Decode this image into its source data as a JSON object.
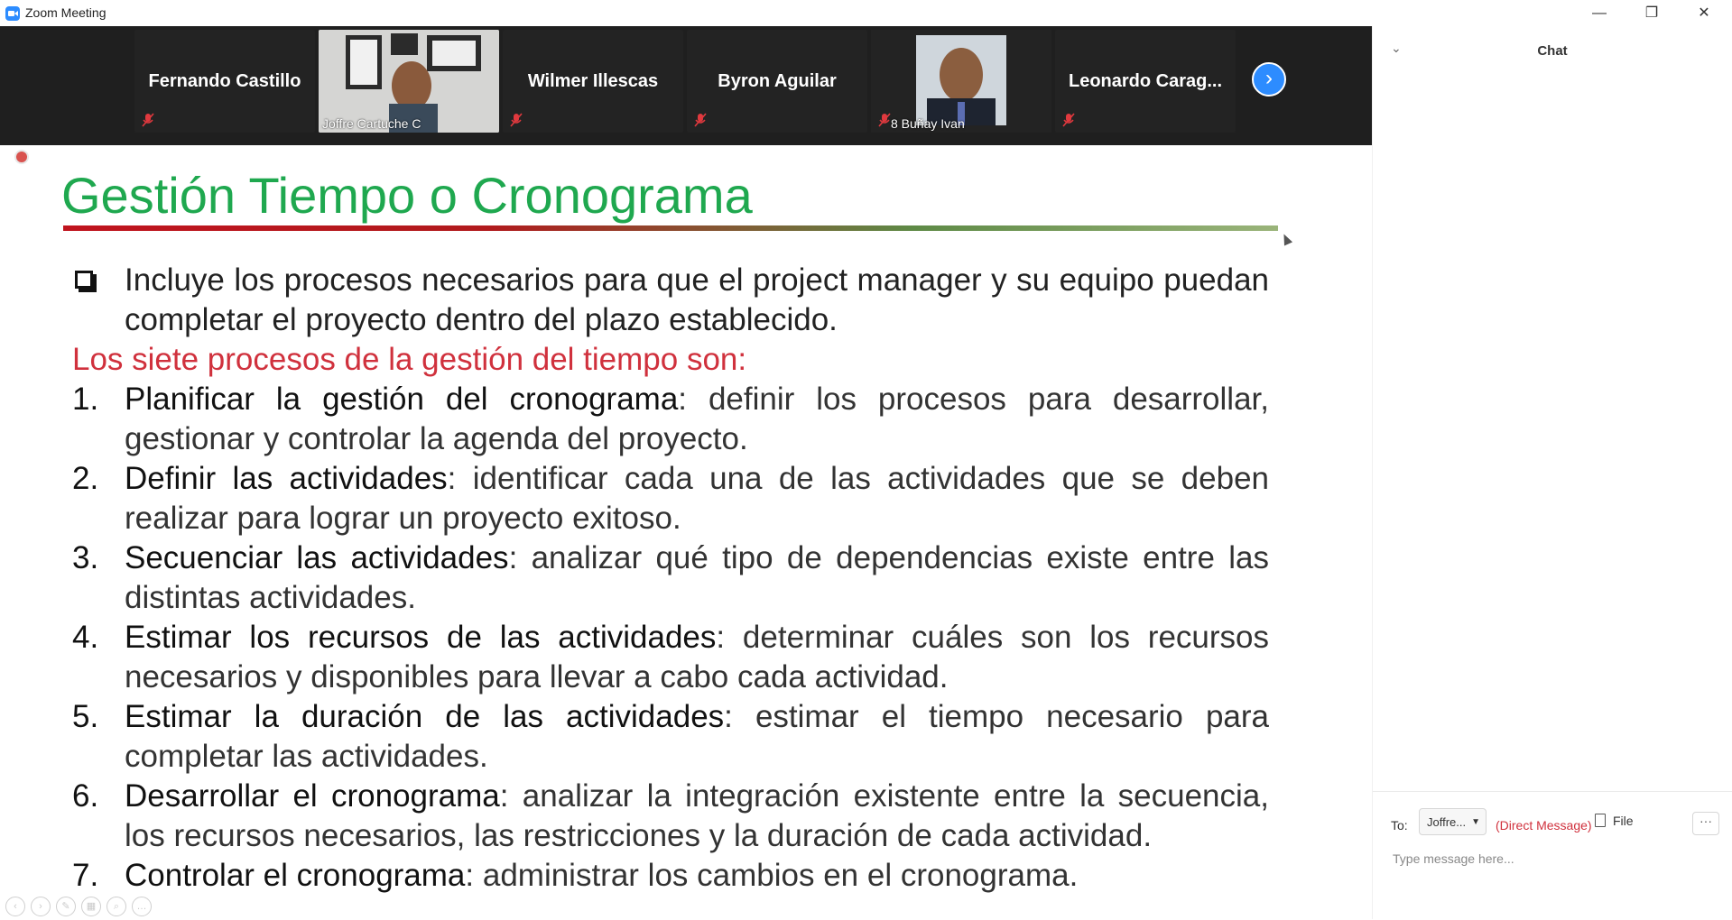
{
  "window": {
    "title": "Zoom Meeting",
    "minimize": "—",
    "restore": "❐",
    "close": "✕"
  },
  "participants": [
    {
      "name": "Fernando Castillo",
      "type": "name"
    },
    {
      "name": "Joffre Cartuche C",
      "type": "video"
    },
    {
      "name": "Wilmer Illescas",
      "type": "name"
    },
    {
      "name": "Byron Aguilar",
      "type": "name"
    },
    {
      "name": "8 Buñay Ivan",
      "type": "video"
    },
    {
      "name": "Leonardo Carag...",
      "type": "name"
    }
  ],
  "strip": {
    "next_icon": "›"
  },
  "slide": {
    "title": "Gestión Tiempo o Cronograma",
    "intro": "Incluye los procesos necesarios para que el project manager y su equipo puedan completar el proyecto dentro del plazo establecido.",
    "subtitle": "Los siete procesos de la gestión del tiempo son:",
    "processes": [
      {
        "num": "1.",
        "term": "Planificar la gestión del cronograma",
        "desc": ": definir los procesos para desarrollar, gestionar y controlar la agenda del proyecto."
      },
      {
        "num": "2.",
        "term": "Definir las actividades",
        "desc": ": identificar cada una de las actividades que se deben realizar para lograr un proyecto exitoso."
      },
      {
        "num": "3.",
        "term": "Secuenciar las actividades",
        "desc": ": analizar qué tipo de dependencias existe entre las distintas actividades."
      },
      {
        "num": "4.",
        "term": "Estimar los recursos de las actividades",
        "desc": ": determinar cuáles son los recursos necesarios y disponibles para llevar a cabo cada actividad."
      },
      {
        "num": "5.",
        "term": "Estimar la duración de las actividades",
        "desc": ": estimar el tiempo necesario para completar las actividades."
      },
      {
        "num": "6.",
        "term": "Desarrollar el cronograma",
        "desc": ": analizar la integración existente entre la secuencia, los recursos necesarios, las restricciones y la duración de cada actividad."
      },
      {
        "num": "7.",
        "term": "Controlar el cronograma",
        "desc": ": administrar los cambios en el cronograma."
      }
    ]
  },
  "chat": {
    "title": "Chat",
    "to_label": "To:",
    "recipient": "Joffre...",
    "direct_message": "(Direct Message)",
    "file_label": "File",
    "more_label": "···",
    "placeholder": "Type message here..."
  }
}
